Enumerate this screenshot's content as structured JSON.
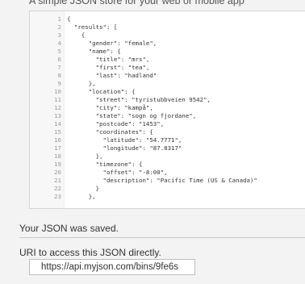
{
  "tagline": "A simple JSON store for your web or mobile app",
  "editor": {
    "lines": [
      {
        "n": "1",
        "t": "{"
      },
      {
        "n": "2",
        "t": "  \"results\": ["
      },
      {
        "n": "3",
        "t": "    {"
      },
      {
        "n": "4",
        "t": "      \"gender\": \"female\","
      },
      {
        "n": "5",
        "t": "      \"name\": {"
      },
      {
        "n": "6",
        "t": "        \"title\": \"mrs\","
      },
      {
        "n": "7",
        "t": "        \"first\": \"tea\","
      },
      {
        "n": "8",
        "t": "        \"last\": \"hadland\""
      },
      {
        "n": "9",
        "t": "      },"
      },
      {
        "n": "10",
        "t": "      \"location\": {"
      },
      {
        "n": "11",
        "t": "        \"street\": \"tyristubbveien 9542\","
      },
      {
        "n": "12",
        "t": "        \"city\": \"kampå\","
      },
      {
        "n": "13",
        "t": "        \"state\": \"sogn og fjordane\","
      },
      {
        "n": "14",
        "t": "        \"postcode\": \"1453\","
      },
      {
        "n": "15",
        "t": "        \"coordinates\": {"
      },
      {
        "n": "16",
        "t": "          \"latitude\": \"54.7771\","
      },
      {
        "n": "17",
        "t": "          \"longitude\": \"87.8317\""
      },
      {
        "n": "18",
        "t": "        },"
      },
      {
        "n": "19",
        "t": "        \"timezone\": {"
      },
      {
        "n": "20",
        "t": "          \"offset\": \"-8:00\","
      },
      {
        "n": "21",
        "t": "          \"description\": \"Pacific Time (US & Canada)\""
      },
      {
        "n": "22",
        "t": "        }"
      },
      {
        "n": "23",
        "t": "      },"
      }
    ]
  },
  "status": {
    "saved_message": "Your JSON was saved."
  },
  "uri": {
    "label": "URI to access this JSON directly.",
    "value": "https://api.myjson.com/bins/9fe6s"
  }
}
